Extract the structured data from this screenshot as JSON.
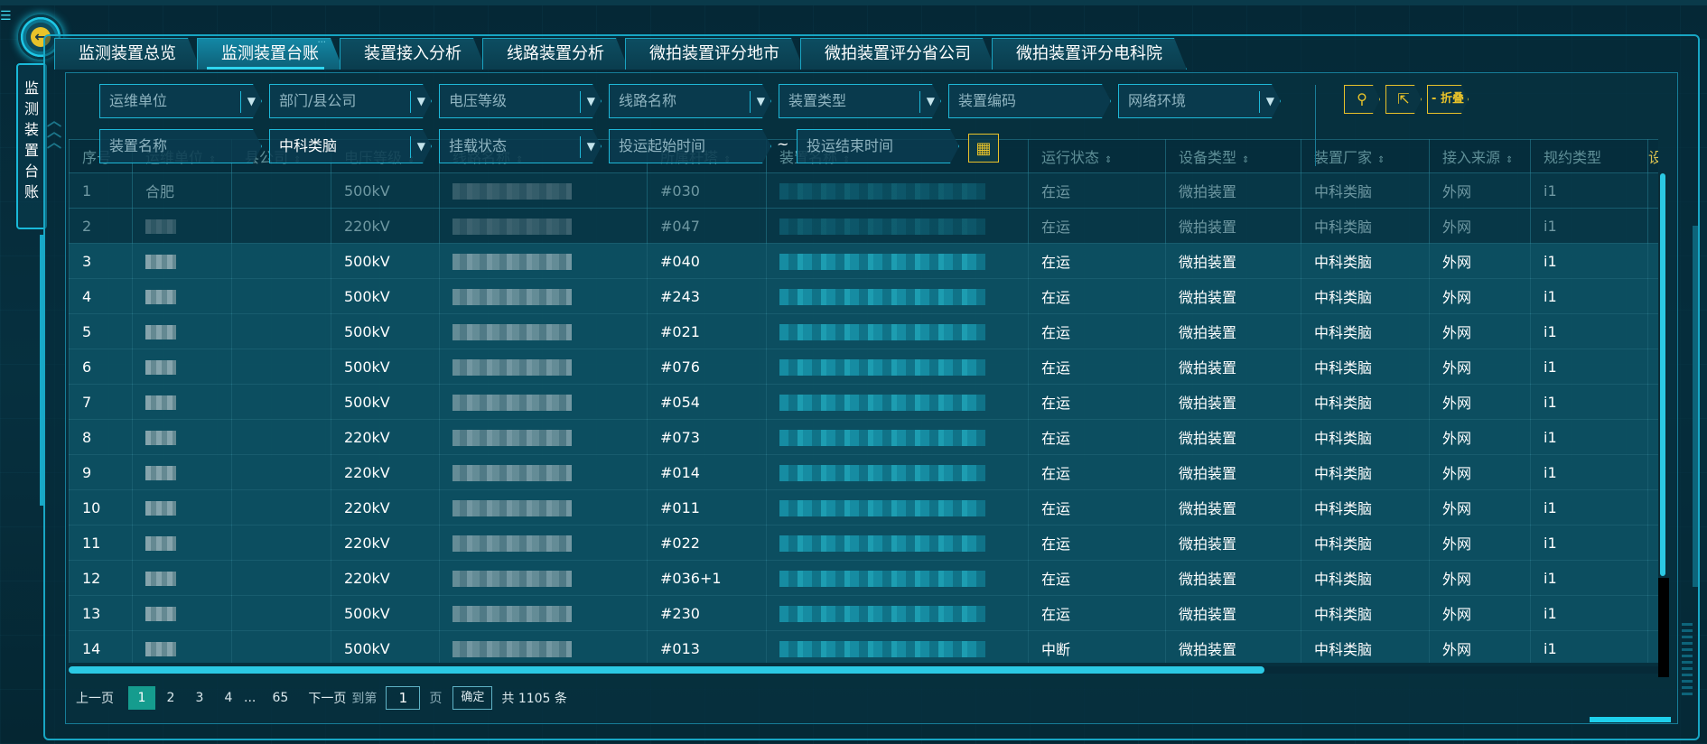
{
  "nav": {
    "side_title": "监测装置台账"
  },
  "tabs": [
    {
      "label": "监测装置总览"
    },
    {
      "label": "监测装置台账"
    },
    {
      "label": "装置接入分析"
    },
    {
      "label": "线路装置分析"
    },
    {
      "label": "微拍装置评分地市"
    },
    {
      "label": "微拍装置评分省公司"
    },
    {
      "label": "微拍装置评分电科院"
    }
  ],
  "filters": {
    "ops_unit": "运维单位",
    "dept": "部门/县公司",
    "voltage": "电压等级",
    "line": "线路名称",
    "device_type": "装置类型",
    "device_code": "装置编码",
    "network": "网络环境",
    "device_name": "装置名称",
    "vendor_value": "中科类脑",
    "mount_state": "挂载状态",
    "start_time": "投运起始时间",
    "range_sep": "~",
    "end_time": "投运结束时间"
  },
  "actions": {
    "fold_label": "- 折叠"
  },
  "table": {
    "columns": [
      "序号",
      "运维单位",
      "县公司",
      "电压等级",
      "线路名称",
      "所属杆塔",
      "装置名称",
      "运行状态",
      "设备类型",
      "装置厂家",
      "接入来源",
      "规约类型",
      "设"
    ],
    "rows": [
      {
        "no": "1",
        "unit": "合肥",
        "voltage": "500kV",
        "tower": "#030",
        "status": "在运",
        "type": "微拍装置",
        "vendor": "中科类脑",
        "source": "外网",
        "protocol": "i1"
      },
      {
        "no": "2",
        "unit": "",
        "voltage": "220kV",
        "tower": "#047",
        "status": "在运",
        "type": "微拍装置",
        "vendor": "中科类脑",
        "source": "外网",
        "protocol": "i1"
      },
      {
        "no": "3",
        "unit": "",
        "voltage": "500kV",
        "tower": "#040",
        "status": "在运",
        "type": "微拍装置",
        "vendor": "中科类脑",
        "source": "外网",
        "protocol": "i1"
      },
      {
        "no": "4",
        "unit": "",
        "voltage": "500kV",
        "tower": "#243",
        "status": "在运",
        "type": "微拍装置",
        "vendor": "中科类脑",
        "source": "外网",
        "protocol": "i1"
      },
      {
        "no": "5",
        "unit": "",
        "voltage": "500kV",
        "tower": "#021",
        "status": "在运",
        "type": "微拍装置",
        "vendor": "中科类脑",
        "source": "外网",
        "protocol": "i1"
      },
      {
        "no": "6",
        "unit": "",
        "voltage": "500kV",
        "tower": "#076",
        "status": "在运",
        "type": "微拍装置",
        "vendor": "中科类脑",
        "source": "外网",
        "protocol": "i1"
      },
      {
        "no": "7",
        "unit": "",
        "voltage": "500kV",
        "tower": "#054",
        "status": "在运",
        "type": "微拍装置",
        "vendor": "中科类脑",
        "source": "外网",
        "protocol": "i1"
      },
      {
        "no": "8",
        "unit": "",
        "voltage": "220kV",
        "tower": "#073",
        "status": "在运",
        "type": "微拍装置",
        "vendor": "中科类脑",
        "source": "外网",
        "protocol": "i1"
      },
      {
        "no": "9",
        "unit": "",
        "voltage": "220kV",
        "tower": "#014",
        "status": "在运",
        "type": "微拍装置",
        "vendor": "中科类脑",
        "source": "外网",
        "protocol": "i1"
      },
      {
        "no": "10",
        "unit": "",
        "voltage": "220kV",
        "tower": "#011",
        "status": "在运",
        "type": "微拍装置",
        "vendor": "中科类脑",
        "source": "外网",
        "protocol": "i1"
      },
      {
        "no": "11",
        "unit": "",
        "voltage": "220kV",
        "tower": "#022",
        "status": "在运",
        "type": "微拍装置",
        "vendor": "中科类脑",
        "source": "外网",
        "protocol": "i1"
      },
      {
        "no": "12",
        "unit": "",
        "voltage": "220kV",
        "tower": "#036+1",
        "status": "在运",
        "type": "微拍装置",
        "vendor": "中科类脑",
        "source": "外网",
        "protocol": "i1"
      },
      {
        "no": "13",
        "unit": "",
        "voltage": "500kV",
        "tower": "#230",
        "status": "在运",
        "type": "微拍装置",
        "vendor": "中科类脑",
        "source": "外网",
        "protocol": "i1"
      },
      {
        "no": "14",
        "unit": "",
        "voltage": "500kV",
        "tower": "#013",
        "status": "中断",
        "type": "微拍装置",
        "vendor": "中科类脑",
        "source": "外网",
        "protocol": "i1"
      }
    ]
  },
  "pagination": {
    "prev": "上一页",
    "pages": [
      "1",
      "2",
      "3",
      "4"
    ],
    "ellipsis": "...",
    "last": "65",
    "next": "下一页",
    "goto_label": "到第",
    "goto_value": "1",
    "page_unit": "页",
    "confirm": "确定",
    "total": "共 1105 条"
  }
}
